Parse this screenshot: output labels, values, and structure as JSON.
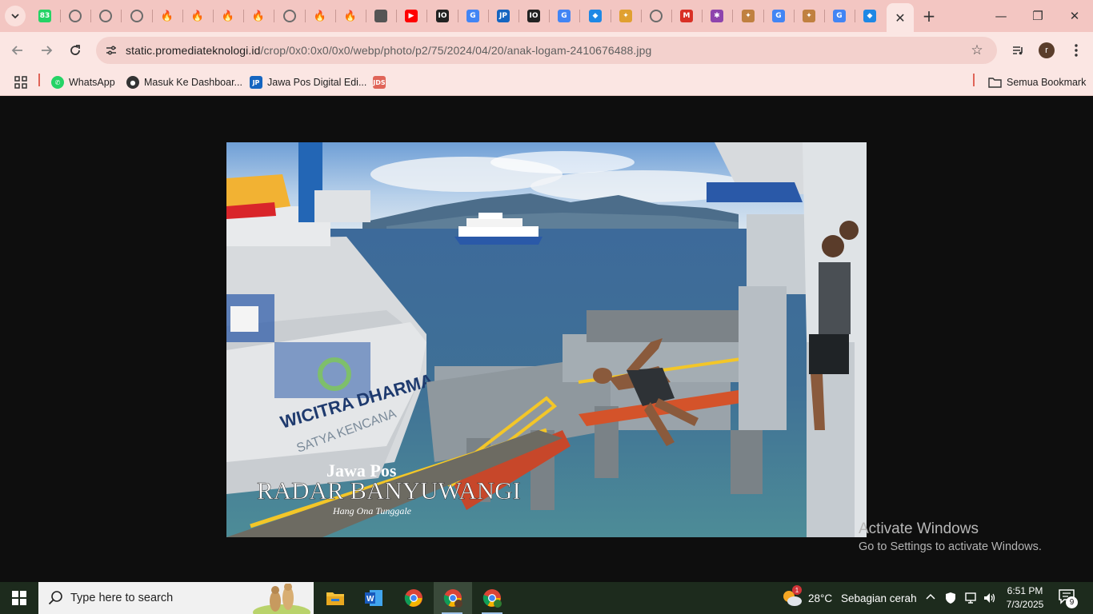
{
  "browser": {
    "active_tab_close": "✕",
    "new_tab": "+",
    "window_controls": {
      "minimize": "—",
      "restore": "❐",
      "close": "✕"
    },
    "tabs": [
      {
        "icon": "whatsapp-icon",
        "color": "#25d366",
        "glyph": "83"
      },
      {
        "icon": "globe-icon",
        "color": "#6b6b6b",
        "glyph": ""
      },
      {
        "icon": "globe-icon",
        "color": "#6b6b6b",
        "glyph": ""
      },
      {
        "icon": "globe-icon",
        "color": "#6b6b6b",
        "glyph": ""
      },
      {
        "icon": "flame-icon",
        "color": "#c0392b",
        "glyph": ""
      },
      {
        "icon": "flame-icon",
        "color": "#c0392b",
        "glyph": ""
      },
      {
        "icon": "flame-icon",
        "color": "#c0392b",
        "glyph": ""
      },
      {
        "icon": "flame-icon",
        "color": "#c0392b",
        "glyph": ""
      },
      {
        "icon": "globe-icon",
        "color": "#6b6b6b",
        "glyph": ""
      },
      {
        "icon": "flame-icon",
        "color": "#c0392b",
        "glyph": ""
      },
      {
        "icon": "flame-icon",
        "color": "#c0392b",
        "glyph": ""
      },
      {
        "icon": "shield-icon",
        "color": "#555555",
        "glyph": ""
      },
      {
        "icon": "youtube-icon",
        "color": "#ff0000",
        "glyph": "▶"
      },
      {
        "icon": "io-icon",
        "color": "#222222",
        "glyph": "IO"
      },
      {
        "icon": "google-icon",
        "color": "#4285f4",
        "glyph": "G"
      },
      {
        "icon": "jawapos-icon",
        "color": "#1565c0",
        "glyph": "JP"
      },
      {
        "icon": "io-icon",
        "color": "#222222",
        "glyph": "IO"
      },
      {
        "icon": "google-icon",
        "color": "#4285f4",
        "glyph": "G"
      },
      {
        "icon": "app-icon",
        "color": "#1e88e5",
        "glyph": "◆"
      },
      {
        "icon": "puzzle-icon",
        "color": "#e0a030",
        "glyph": "✦"
      },
      {
        "icon": "globe-icon",
        "color": "#6b6b6b",
        "glyph": ""
      },
      {
        "icon": "gmail-icon",
        "color": "#d93025",
        "glyph": "M"
      },
      {
        "icon": "colorful-app-icon",
        "color": "#8e44ad",
        "glyph": "✱"
      },
      {
        "icon": "gemini-icon",
        "color": "#c08040",
        "glyph": "✦"
      },
      {
        "icon": "google-icon",
        "color": "#4285f4",
        "glyph": "G"
      },
      {
        "icon": "gemini-icon",
        "color": "#c08040",
        "glyph": "✦"
      },
      {
        "icon": "google-icon",
        "color": "#4285f4",
        "glyph": "G"
      },
      {
        "icon": "app-icon",
        "color": "#1e88e5",
        "glyph": "◆"
      }
    ],
    "url_host": "static.promediateknologi.id",
    "url_path": "/crop/0x0:0x0/0x0/webp/photo/p2/75/2024/04/20/anak-logam-2410676488.jpg",
    "profile_initial": "r",
    "bookmarks": [
      {
        "label": "WhatsApp",
        "icon": "whatsapp-icon",
        "color": "#25d366",
        "glyph": "✆"
      },
      {
        "label": "Masuk Ke Dashboar...",
        "icon": "globe-icon",
        "color": "#333333",
        "glyph": "●"
      },
      {
        "label": "Jawa Pos Digital Edi...",
        "icon": "jawapos-icon",
        "color": "#1565c0",
        "glyph": "JP"
      },
      {
        "label": "",
        "icon": "jds-icon",
        "color": "#e06458",
        "glyph": "JDS"
      }
    ],
    "all_bookmarks_label": "Semua Bookmark"
  },
  "photo": {
    "ship_name": "WICITRA DHARMA III",
    "ship_subtitle": "SATYA KENCANA",
    "watermark_top": "Jawa Pos",
    "watermark_main": "RADAR BANYUWANGI",
    "watermark_credit": "Hang Ona Tunggale"
  },
  "activation": {
    "title": "Activate Windows",
    "subtitle": "Go to Settings to activate Windows."
  },
  "taskbar": {
    "search_placeholder": "Type here to search",
    "weather_temp": "28°C",
    "weather_desc": "Sebagian cerah",
    "weather_badge": "1",
    "time": "6:51 PM",
    "date": "7/3/2025",
    "notification_count": "9",
    "apps": [
      {
        "name": "file-explorer-icon"
      },
      {
        "name": "word-icon"
      },
      {
        "name": "chrome-icon"
      },
      {
        "name": "chrome-profile-icon"
      },
      {
        "name": "chrome-profile-h-icon"
      }
    ]
  }
}
